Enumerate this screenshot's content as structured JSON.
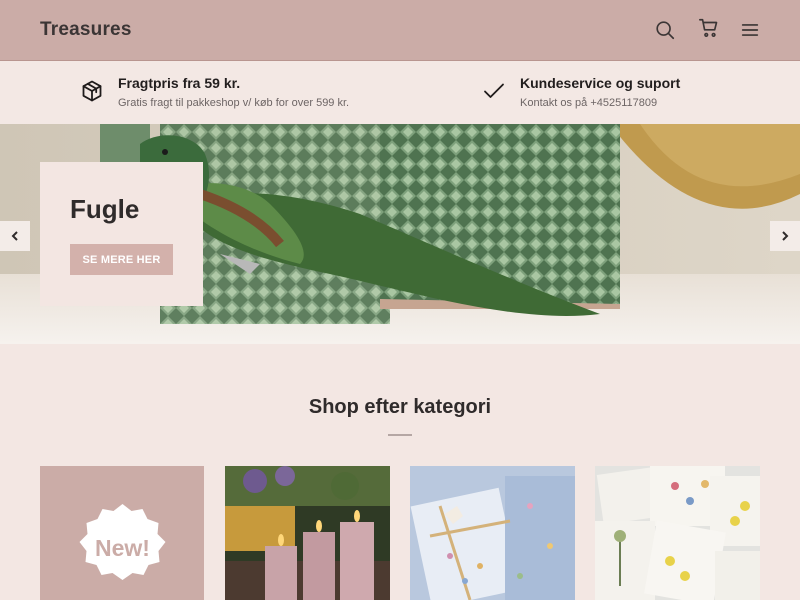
{
  "header": {
    "logo": "Treasures",
    "icons": [
      "search-icon",
      "cart-icon",
      "menu-icon"
    ]
  },
  "info": [
    {
      "icon": "box-icon",
      "title": "Fragtpris fra 59 kr.",
      "subtitle": "Gratis fragt til pakkeshop v/ køb for over 599 kr."
    },
    {
      "icon": "check-icon",
      "title": "Kundeservice og suport",
      "subtitle": "Kontakt os på +4525117809"
    }
  ],
  "hero": {
    "title": "Fugle",
    "button": "SE MERE HER"
  },
  "section": {
    "title": "Shop efter kategori"
  },
  "categories": [
    {
      "badge": "New!"
    }
  ],
  "colors": {
    "header_bg": "#cbaca7",
    "page_bg": "#f3e7e3",
    "button_bg": "#d3b1ab"
  }
}
